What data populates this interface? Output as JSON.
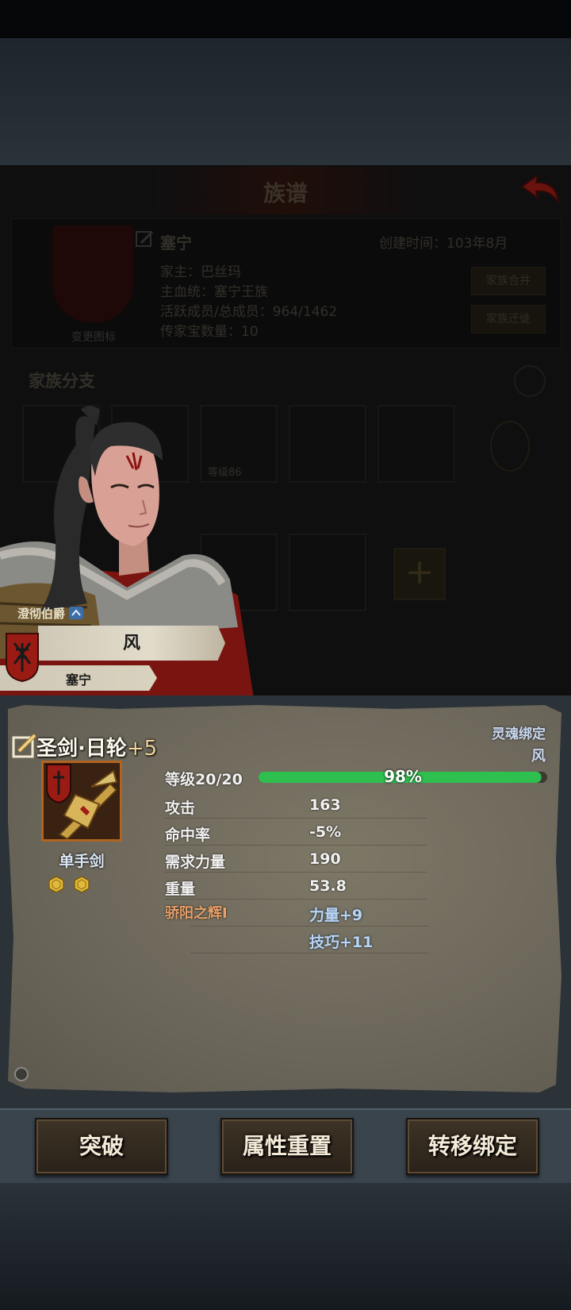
{
  "genealogy": {
    "title": "族谱",
    "family_name": "塞宁",
    "created_label": "创建时间：",
    "created_value": "103年8月",
    "head_line": "家主：巴丝玛",
    "bloodline_line": "主血统：塞宁王族",
    "active_line": "活跃成员/总成员：964/1462",
    "heirloom_line": "传家宝数量：10",
    "merge_button": "家族合并",
    "migrate_button": "家族迁徙",
    "change_crest": "变更图标",
    "branch_label": "家族分支",
    "member_level": "等级86"
  },
  "character": {
    "rank": "澄彻伯爵",
    "name": "风",
    "house": "塞宁"
  },
  "weapon": {
    "name": "圣剑·日轮",
    "enhance": "+5",
    "bind_status": "灵魂绑定",
    "bound_to": "风",
    "type": "单手剑",
    "gem_slots": 2,
    "level_label": "等级20/20",
    "exp_percent": 98,
    "exp_text": "98%",
    "stats": [
      {
        "label": "攻击",
        "value": "163"
      },
      {
        "label": "命中率",
        "value": "-5%"
      },
      {
        "label": "需求力量",
        "value": "190"
      },
      {
        "label": "重量",
        "value": "53.8"
      }
    ],
    "passive_name": "骄阳之辉I",
    "bonuses": [
      "力量+9",
      "技巧+11"
    ]
  },
  "actions": {
    "breakthrough": "突破",
    "reset_attributes": "属性重置",
    "transfer_binding": "转移绑定"
  },
  "colors": {
    "exp_bar": "#2fbf4f",
    "passive": "#e8a16a",
    "bonus": "#b9d4f4",
    "banner_red": "#9a1b14"
  }
}
